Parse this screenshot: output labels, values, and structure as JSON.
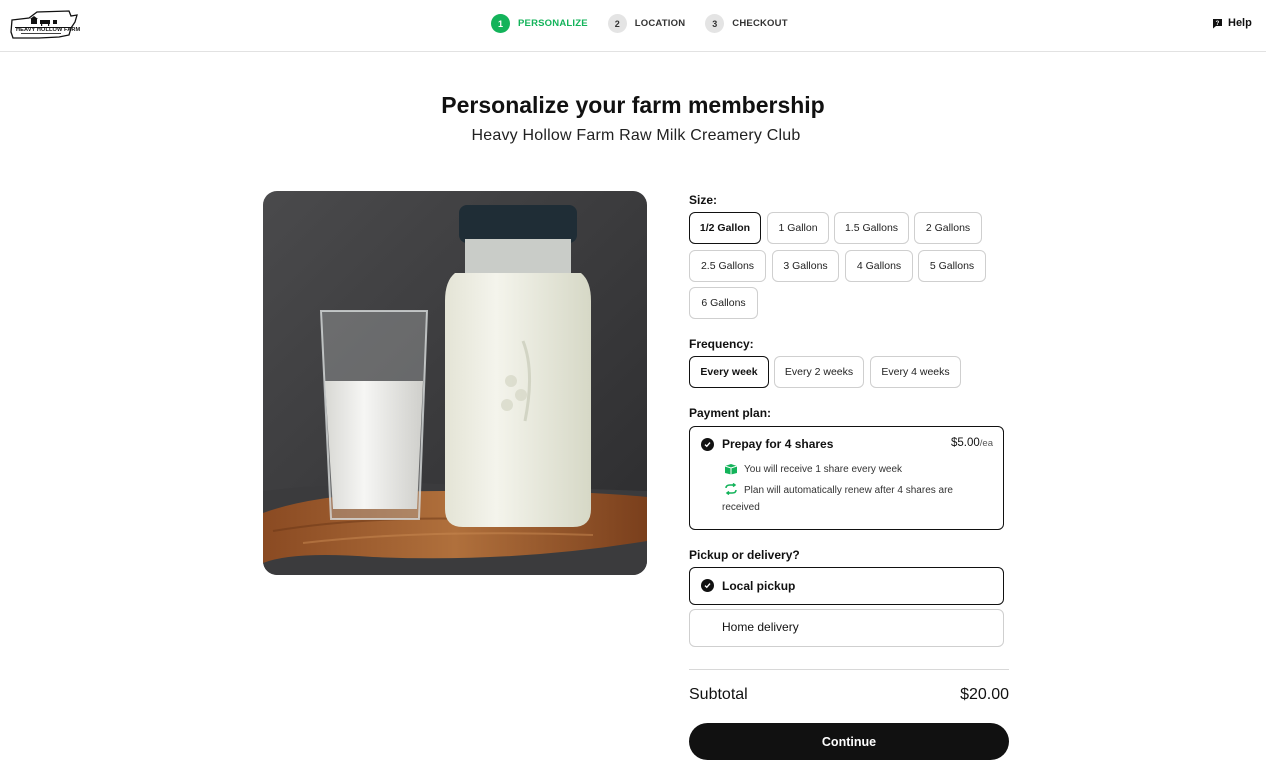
{
  "header": {
    "logo_text": "HEAVY HOLLOW FARM",
    "steps": [
      {
        "num": "1",
        "label": "PERSONALIZE"
      },
      {
        "num": "2",
        "label": "LOCATION"
      },
      {
        "num": "3",
        "label": "CHECKOUT"
      }
    ],
    "active_step": 1,
    "help_label": "Help",
    "accent_color": "#13b35a"
  },
  "main": {
    "title": "Personalize your farm membership",
    "subtitle": "Heavy Hollow Farm Raw Milk Creamery Club"
  },
  "size": {
    "label": "Size:",
    "options": [
      "1/2 Gallon",
      "1 Gallon",
      "1.5 Gallons",
      "2 Gallons",
      "2.5 Gallons",
      "3 Gallons",
      "4 Gallons",
      "5 Gallons",
      "6 Gallons"
    ],
    "selected": "1/2 Gallon"
  },
  "frequency": {
    "label": "Frequency:",
    "options": [
      "Every week",
      "Every 2 weeks",
      "Every 4 weeks"
    ],
    "selected": "Every week"
  },
  "payment": {
    "label": "Payment plan:",
    "plan_name": "Prepay for 4 shares",
    "price": "$5.00",
    "price_unit": "/ea",
    "line1": "You will receive 1 share every week",
    "line2a": "Plan will automatically renew after 4 shares are",
    "line2b": "received"
  },
  "fulfillment": {
    "label": "Pickup or delivery?",
    "options": [
      "Local pickup",
      "Home delivery"
    ],
    "selected": "Local pickup"
  },
  "summary": {
    "subtotal_label": "Subtotal",
    "subtotal_value": "$20.00",
    "continue_label": "Continue"
  }
}
